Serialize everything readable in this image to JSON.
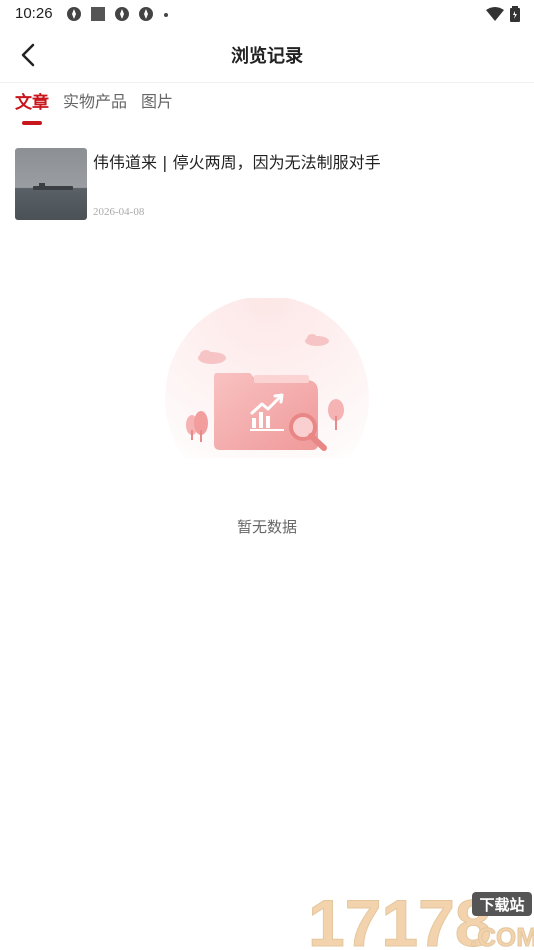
{
  "status_bar": {
    "time": "10:26"
  },
  "header": {
    "title": "浏览记录"
  },
  "tabs": [
    {
      "label": "文章",
      "active": true
    },
    {
      "label": "实物产品",
      "active": false
    },
    {
      "label": "图片",
      "active": false
    }
  ],
  "articles": [
    {
      "title": "伟伟道来 | 停火两周，因为无法制服对手",
      "date": "2026-04-08"
    }
  ],
  "empty_state": {
    "text": "暂无数据"
  },
  "watermark": {
    "number": "17178",
    "badge": "下载站",
    "domain": ".COM"
  },
  "colors": {
    "accent": "#c8161d",
    "illustration": "#f3a7a6"
  }
}
